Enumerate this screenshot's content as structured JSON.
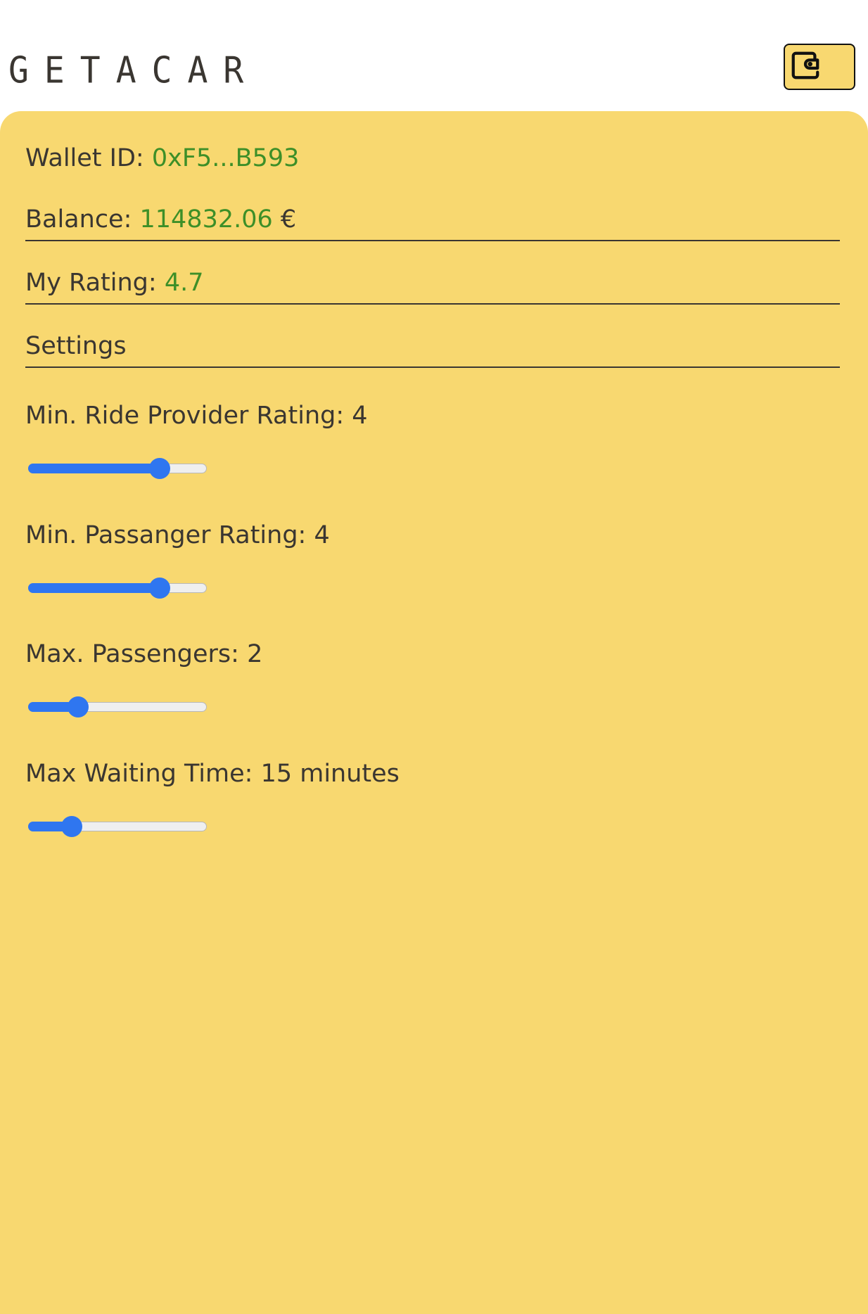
{
  "header": {
    "logo_text": "GETACAR",
    "wallet_button_icon": "wallet-icon"
  },
  "account": {
    "wallet_id_label": "Wallet ID: ",
    "wallet_id_value": "0xF5...B593",
    "balance_label": "Balance: ",
    "balance_value": "114832.06",
    "balance_currency": " €",
    "rating_label": "My Rating: ",
    "rating_value": "4.7",
    "settings_label": "Settings"
  },
  "settings": [
    {
      "label": "Min. Ride Provider Rating: 4",
      "fraction": 0.77
    },
    {
      "label": "Min. Passanger Rating: 4",
      "fraction": 0.77
    },
    {
      "label": "Max. Passengers: 2",
      "fraction": 0.25
    },
    {
      "label": "Max Waiting Time: 15 minutes",
      "fraction": 0.21
    }
  ],
  "colors": {
    "panel_background": "#f8d870",
    "value_green": "#3d8f28",
    "slider_blue": "#2f76f0",
    "text_dark": "#3a3631"
  }
}
